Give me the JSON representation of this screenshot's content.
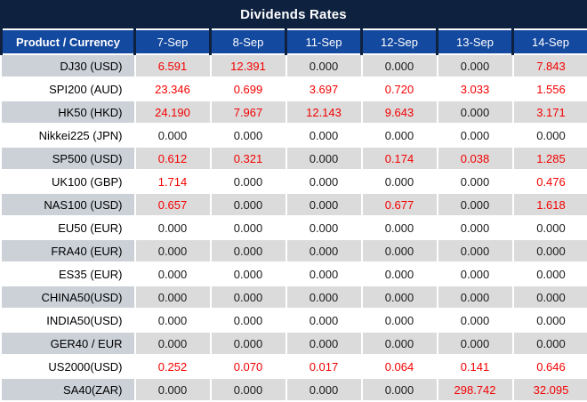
{
  "title": "Dividends Rates",
  "colors": {
    "navy": "#0e2240",
    "header_blue": "#1449a0",
    "row_gray": "#dbdbdb",
    "product_gray": "#ccd1d8",
    "red": "#f40000",
    "ink": "#1a1a1a"
  },
  "table": {
    "product_header": "Product / Currency",
    "date_headers": [
      "7-Sep",
      "8-Sep",
      "11-Sep",
      "12-Sep",
      "13-Sep",
      "14-Sep"
    ],
    "rows": [
      {
        "product": "DJ30 (USD)",
        "values": [
          "6.591",
          "12.391",
          "0.000",
          "0.000",
          "0.000",
          "7.843"
        ],
        "red": [
          1,
          1,
          0,
          0,
          0,
          1
        ]
      },
      {
        "product": "SPI200 (AUD)",
        "values": [
          "23.346",
          "0.699",
          "3.697",
          "0.720",
          "3.033",
          "1.556"
        ],
        "red": [
          1,
          1,
          1,
          1,
          1,
          1
        ]
      },
      {
        "product": "HK50 (HKD)",
        "values": [
          "24.190",
          "7.967",
          "12.143",
          "9.643",
          "0.000",
          "3.171"
        ],
        "red": [
          1,
          1,
          1,
          1,
          0,
          1
        ]
      },
      {
        "product": "Nikkei225 (JPN)",
        "values": [
          "0.000",
          "0.000",
          "0.000",
          "0.000",
          "0.000",
          "0.000"
        ],
        "red": [
          0,
          0,
          0,
          0,
          0,
          0
        ]
      },
      {
        "product": "SP500 (USD)",
        "values": [
          "0.612",
          "0.321",
          "0.000",
          "0.174",
          "0.038",
          "1.285"
        ],
        "red": [
          1,
          1,
          0,
          1,
          1,
          1
        ]
      },
      {
        "product": "UK100 (GBP)",
        "values": [
          "1.714",
          "0.000",
          "0.000",
          "0.000",
          "0.000",
          "0.476"
        ],
        "red": [
          1,
          0,
          0,
          0,
          0,
          1
        ]
      },
      {
        "product": "NAS100 (USD)",
        "values": [
          "0.657",
          "0.000",
          "0.000",
          "0.677",
          "0.000",
          "1.618"
        ],
        "red": [
          1,
          0,
          0,
          1,
          0,
          1
        ]
      },
      {
        "product": "EU50 (EUR)",
        "values": [
          "0.000",
          "0.000",
          "0.000",
          "0.000",
          "0.000",
          "0.000"
        ],
        "red": [
          0,
          0,
          0,
          0,
          0,
          0
        ]
      },
      {
        "product": "FRA40 (EUR)",
        "values": [
          "0.000",
          "0.000",
          "0.000",
          "0.000",
          "0.000",
          "0.000"
        ],
        "red": [
          0,
          0,
          0,
          0,
          0,
          0
        ]
      },
      {
        "product": "ES35 (EUR)",
        "values": [
          "0.000",
          "0.000",
          "0.000",
          "0.000",
          "0.000",
          "0.000"
        ],
        "red": [
          0,
          0,
          0,
          0,
          0,
          0
        ]
      },
      {
        "product": "CHINA50(USD)",
        "values": [
          "0.000",
          "0.000",
          "0.000",
          "0.000",
          "0.000",
          "0.000"
        ],
        "red": [
          0,
          0,
          0,
          0,
          0,
          0
        ]
      },
      {
        "product": "INDIA50(USD)",
        "values": [
          "0.000",
          "0.000",
          "0.000",
          "0.000",
          "0.000",
          "0.000"
        ],
        "red": [
          0,
          0,
          0,
          0,
          0,
          0
        ]
      },
      {
        "product": "GER40 / EUR",
        "values": [
          "0.000",
          "0.000",
          "0.000",
          "0.000",
          "0.000",
          "0.000"
        ],
        "red": [
          0,
          0,
          0,
          0,
          0,
          0
        ]
      },
      {
        "product": "US2000(USD)",
        "values": [
          "0.252",
          "0.070",
          "0.017",
          "0.064",
          "0.141",
          "0.646"
        ],
        "red": [
          1,
          1,
          1,
          1,
          1,
          1
        ]
      },
      {
        "product": "SA40(ZAR)",
        "values": [
          "0.000",
          "0.000",
          "0.000",
          "0.000",
          "298.742",
          "32.095"
        ],
        "red": [
          0,
          0,
          0,
          0,
          1,
          1
        ]
      }
    ]
  }
}
